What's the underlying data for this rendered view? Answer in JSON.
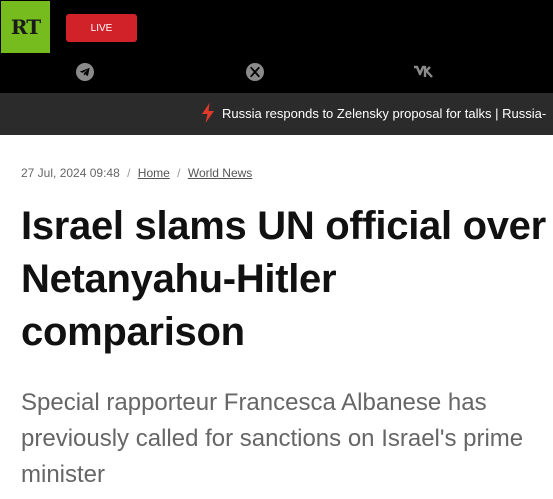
{
  "header": {
    "logo_text": "RT",
    "live_label": "LIVE",
    "social_icons": [
      "telegram-icon",
      "x-twitter-icon",
      "vk-icon"
    ]
  },
  "ticker": {
    "icon": "lightning-icon",
    "text": "Russia responds to Zelensky proposal for talks | Russia-"
  },
  "article": {
    "date": "27 Jul, 2024 09:48",
    "separator": "/",
    "breadcrumb": [
      "Home",
      "World News"
    ],
    "title": "Israel slams UN official over Netanyahu-Hitler comparison",
    "summary": "Special rapporteur Francesca Albanese has previously called for sanctions on Israel's prime minister"
  },
  "colors": {
    "logo_bg": "#77bc1f",
    "live_bg": "#d1222a",
    "ticker_bg": "#2b2b2b",
    "bolt": "#e03a2c"
  }
}
